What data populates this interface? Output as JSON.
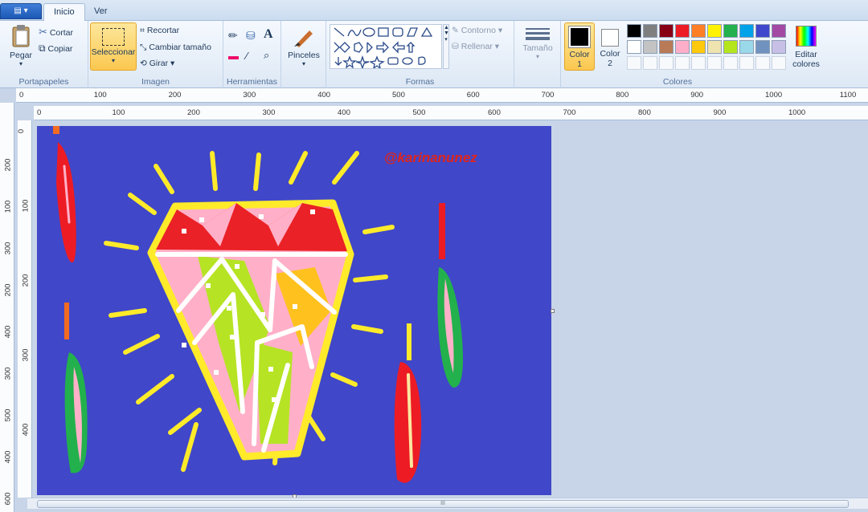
{
  "tabs": {
    "menu": "▤ ▾",
    "home": "Inicio",
    "view": "Ver"
  },
  "clipboard": {
    "paste": "Pegar",
    "cut": "Cortar",
    "copy": "Copiar",
    "group": "Portapapeles"
  },
  "image": {
    "select": "Seleccionar",
    "crop": "Recortar",
    "resize": "Cambiar tamaño",
    "rotate": "Girar",
    "group": "Imagen"
  },
  "tools": {
    "group": "Herramientas",
    "text_icon": "A"
  },
  "brushes": {
    "label": "Pinceles"
  },
  "shapes": {
    "outline": "Contorno",
    "fill": "Rellenar",
    "group": "Formas"
  },
  "size": {
    "label": "Tamaño"
  },
  "colors": {
    "color1": "Color",
    "color1_num": "1",
    "color2": "Color",
    "color2_num": "2",
    "edit": "Editar",
    "edit2": "colores",
    "group": "Colores",
    "row1": [
      "#000000",
      "#7f7f7f",
      "#880015",
      "#ed1c24",
      "#ff7f27",
      "#fff200",
      "#22b14c",
      "#00a2e8",
      "#3f48cc",
      "#a349a4"
    ],
    "row2": [
      "#ffffff",
      "#c3c3c3",
      "#b97a57",
      "#ffaec9",
      "#ffc90e",
      "#efe4b0",
      "#b5e61d",
      "#99d9ea",
      "#7092be",
      "#c8bfe7"
    ]
  },
  "rulers": {
    "top": [
      "0",
      "100",
      "200",
      "300",
      "400",
      "500",
      "600",
      "700",
      "800",
      "900",
      "1000",
      "1100"
    ],
    "h": [
      "0",
      "100",
      "200",
      "300",
      "400",
      "500",
      "600",
      "700",
      "800",
      "900",
      "1000"
    ],
    "vleft": [
      "200",
      "100",
      "300",
      "200",
      "400",
      "300",
      "500",
      "400",
      "600"
    ],
    "v": [
      "0",
      "100",
      "200",
      "300",
      "400"
    ]
  },
  "drawing": {
    "watermark": "@karinanunez"
  },
  "scroll": {
    "grip": "III"
  }
}
